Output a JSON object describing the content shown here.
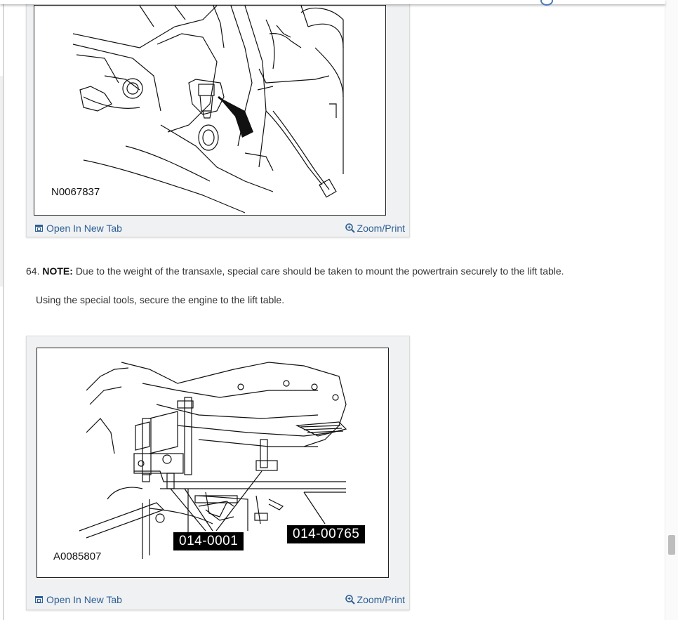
{
  "figures": [
    {
      "image_id": "N0067837",
      "open_label": "Open In New Tab",
      "zoom_label": "Zoom/Print"
    },
    {
      "image_id": "A0085807",
      "callouts": [
        "014-0001",
        "014-00765"
      ],
      "open_label": "Open In New Tab",
      "zoom_label": "Zoom/Print"
    }
  ],
  "steps": [
    {
      "number": "64.",
      "note_label": "NOTE:",
      "note_text": "Due to the weight of the transaxle, special care should be taken to mount the powertrain securely to the lift table.",
      "instruction": "Using the special tools, secure the engine to the lift table."
    }
  ],
  "icons": {
    "open_tab": "open-in-new-tab-icon",
    "zoom": "zoom-magnifier-icon"
  },
  "colors": {
    "link": "#2c5f95",
    "figure_bar": "#f0f1f3"
  }
}
